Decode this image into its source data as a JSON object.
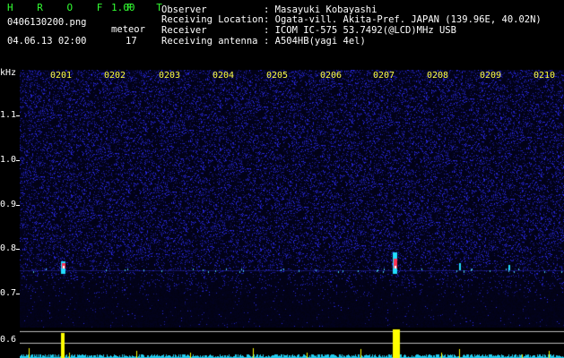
{
  "header": {
    "app_name": "H R O F F T",
    "version": "1.00",
    "filename": "0406130200.png",
    "datetime": "04.06.13 02:00",
    "meteor_label": "meteor",
    "meteor_count": "17",
    "info_labels": [
      "Observer",
      "Receiving Location",
      "Receiver",
      "Receiving antenna"
    ],
    "info_values": [
      ": Masayuki Kobayashi",
      ": Ogata-vill. Akita-Pref. JAPAN (139.96E, 40.02N)",
      ": ICOM IC-575 53.7492(@LCD)MHz USB",
      ": A504HB(yagi 4el)"
    ]
  },
  "axis": {
    "unit": "kHz",
    "y_ticks": [
      "1.1",
      "1.0",
      "0.9",
      "0.8",
      "0.7",
      "0.6"
    ],
    "x_ticks": [
      "0201",
      "0202",
      "0203",
      "0204",
      "0205",
      "0206",
      "0207",
      "0208",
      "0209",
      "0210"
    ]
  },
  "colors": {
    "header_green": "#33ff33",
    "tick_yellow": "#ffff44",
    "noise_blue": "#2a2aff",
    "echo_red": "#ff3355",
    "echo_cyan": "#22ddff",
    "trace_yellow": "#ffff00"
  }
}
